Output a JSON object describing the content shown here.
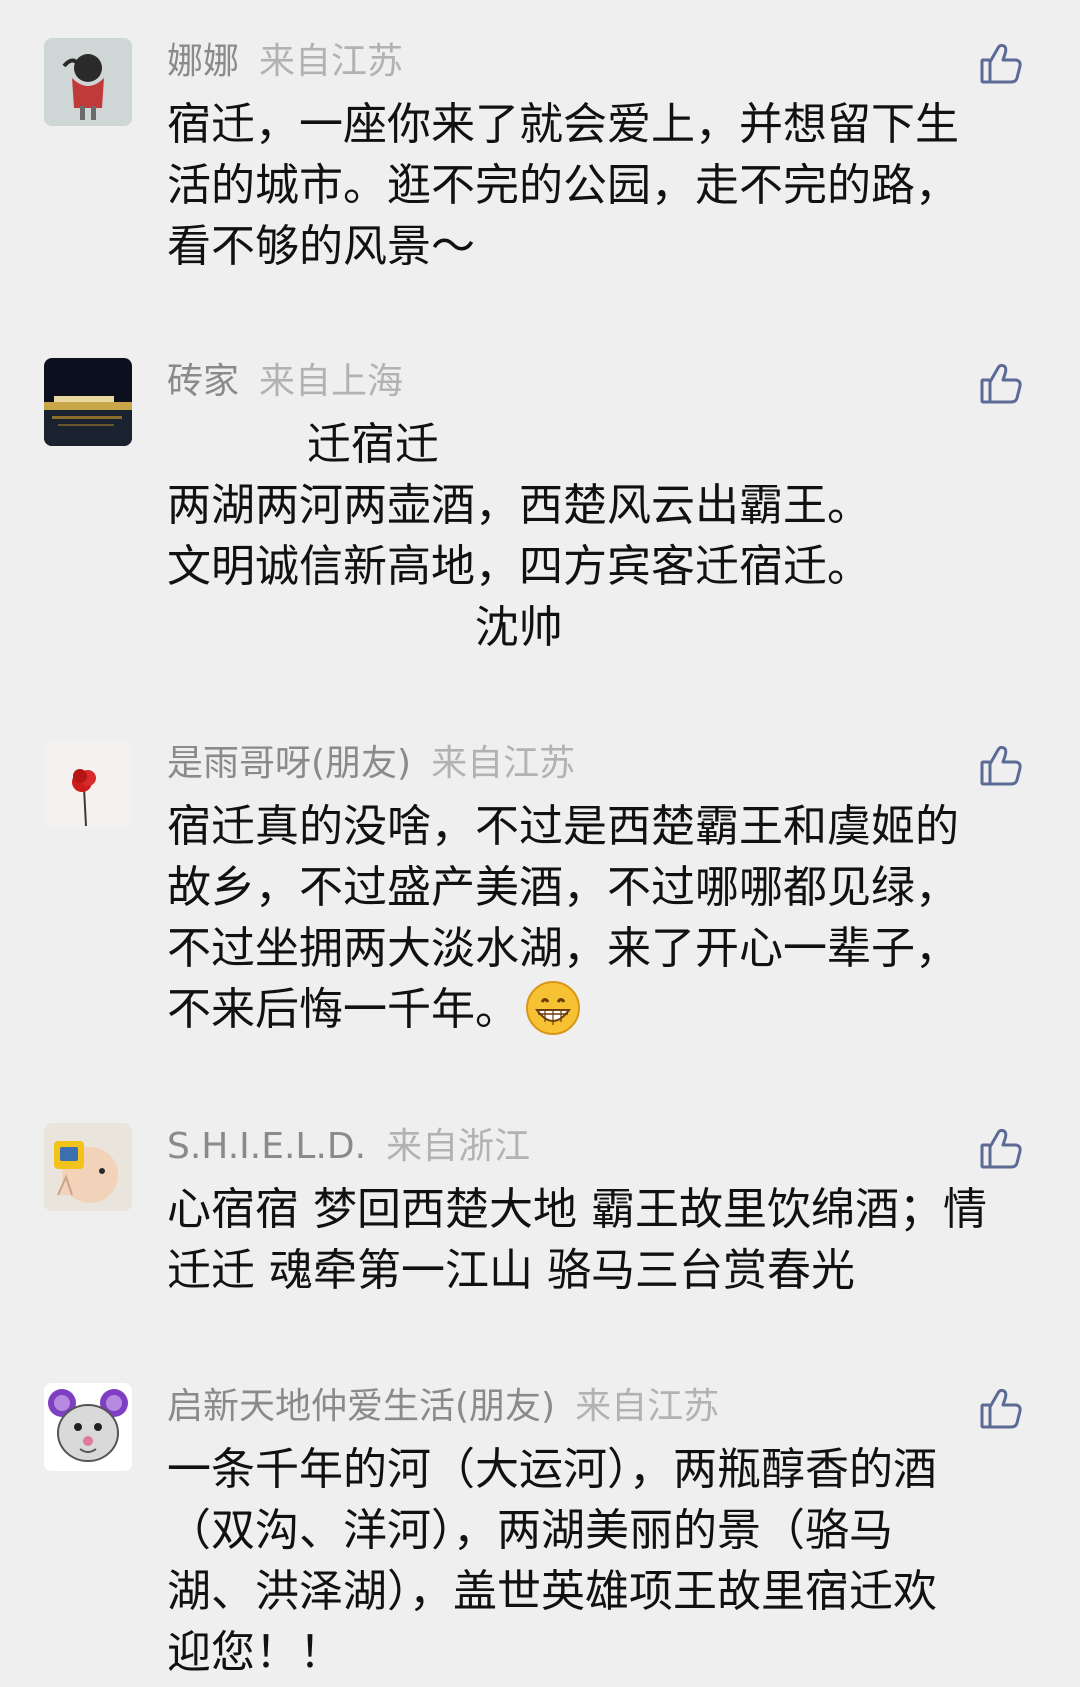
{
  "comments": [
    {
      "name": "娜娜",
      "location": "来自江苏",
      "lines": [
        "宿迁，一座你来了就会爱上，并想留下生",
        "活的城市。逛不完的公园，走不完的路，",
        "看不够的风景～"
      ]
    },
    {
      "name": "砖家",
      "location": "来自上海",
      "lines": [
        "          迁宿迁",
        "两湖两河两壶酒，西楚风云出霸王。",
        "文明诚信新高地，四方宾客迁宿迁。",
        "                      沈帅"
      ]
    },
    {
      "name": "是雨哥呀(朋友)",
      "location": "来自江苏",
      "lines": [
        "宿迁真的没啥，不过是西楚霸王和虞姬的",
        "故乡，不过盛产美酒，不过哪哪都见绿，",
        "不过坐拥两大淡水湖，来了开心一辈子，",
        "不来后悔一千年。"
      ],
      "trailing_emoji": "grinning-emoji"
    },
    {
      "name": "S.H.I.E.L.D.",
      "location": "来自浙江",
      "lines": [
        "心宿宿 梦回西楚大地 霸王故里饮绵酒；情",
        "迁迁 魂牵第一江山 骆马三台赏春光"
      ]
    },
    {
      "name": "启新天地仲爱生活(朋友)",
      "location": "来自江苏",
      "lines": [
        "一条千年的河（大运河），两瓶醇香的酒",
        "（双沟、洋河），两湖美丽的景（骆马",
        "湖、洪泽湖），盖世英雄项王故里宿迁欢",
        "迎您！！"
      ]
    }
  ],
  "icons": {
    "like": "thumbs-up-icon",
    "like_color": "#5b6b95",
    "emoji": "grinning-emoji"
  }
}
